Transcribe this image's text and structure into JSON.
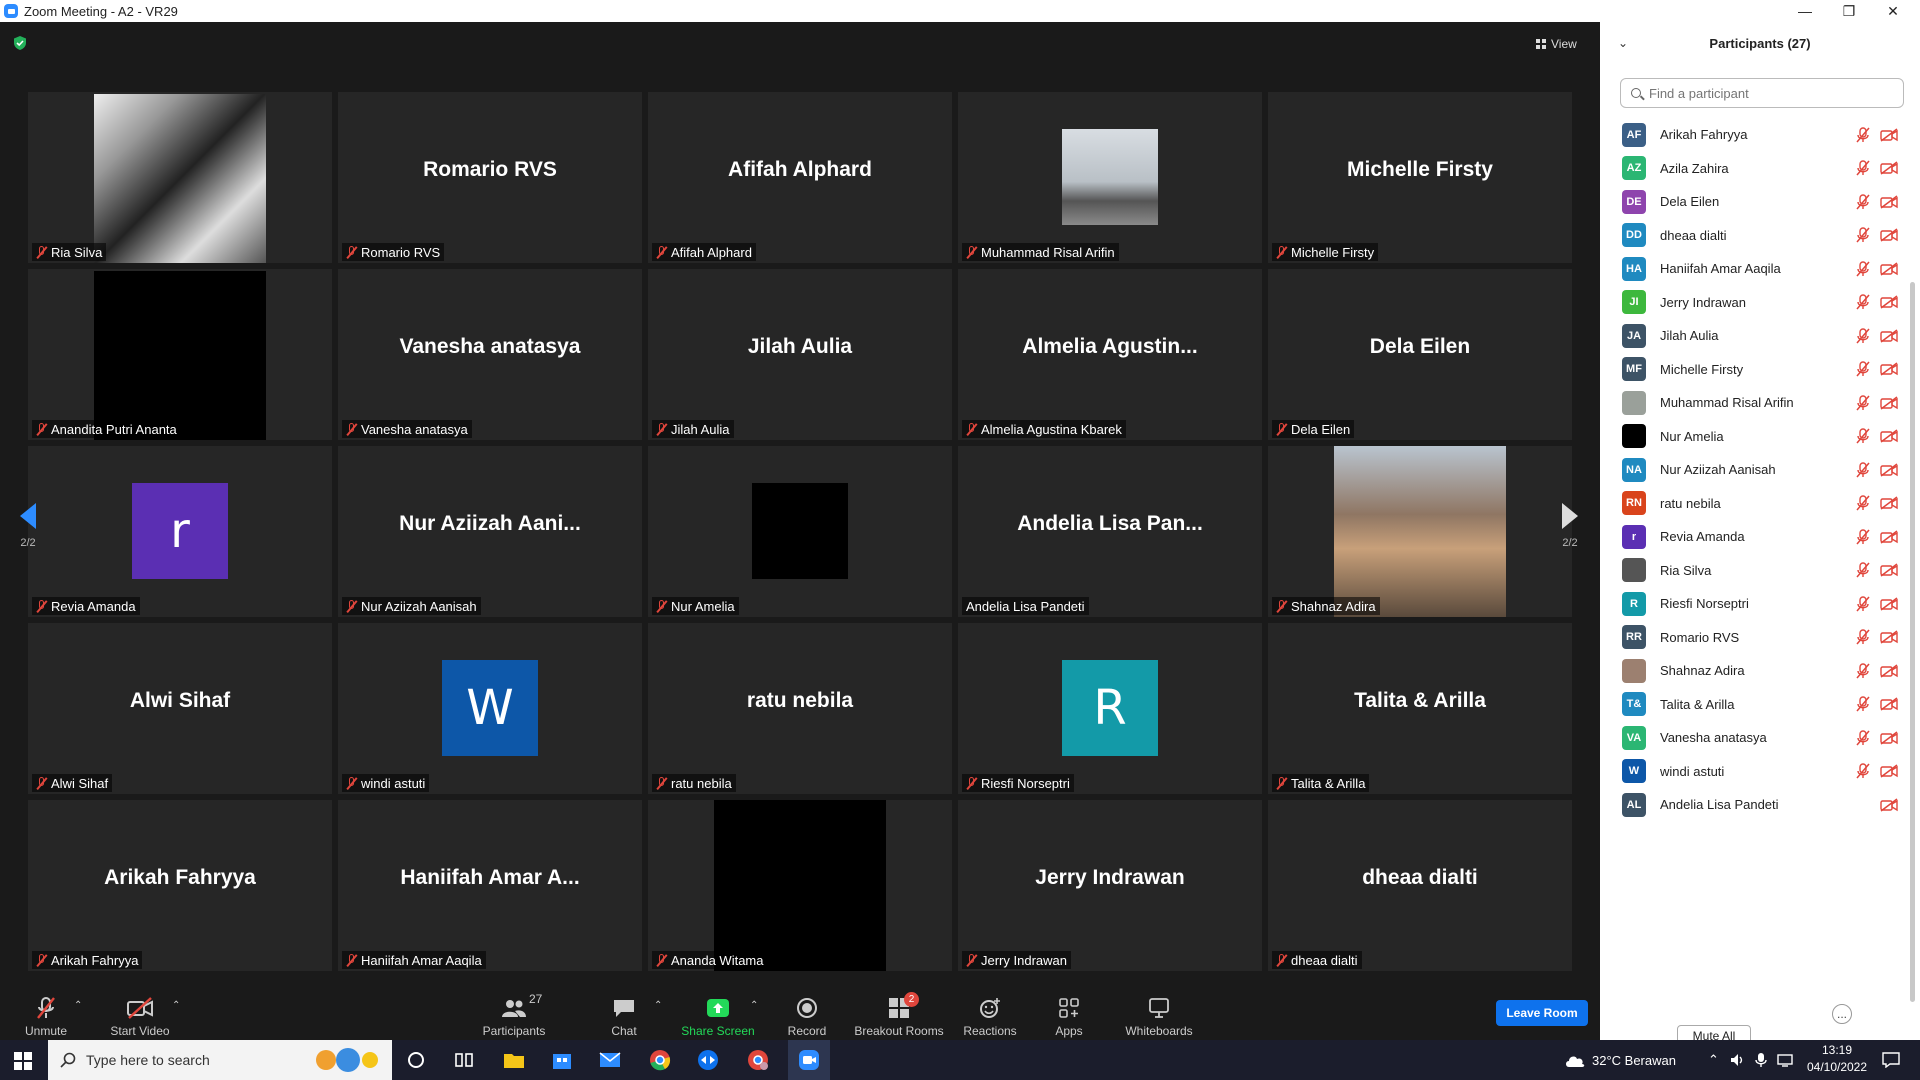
{
  "window": {
    "title": "Zoom Meeting - A2 - VR29"
  },
  "top": {
    "view_label": "View"
  },
  "pager": {
    "left_label": "2/2",
    "right_label": "2/2"
  },
  "tiles": [
    {
      "big": "",
      "label": "Ria Silva",
      "muted": true
    },
    {
      "big": "Romario RVS",
      "label": "Romario RVS",
      "muted": true
    },
    {
      "big": "Afifah Alphard",
      "label": "Afifah Alphard",
      "muted": true
    },
    {
      "big": "",
      "label": "Muhammad Risal Arifin",
      "muted": true
    },
    {
      "big": "Michelle Firsty",
      "label": "Michelle Firsty",
      "muted": true
    },
    {
      "big": "",
      "label": "Anandita Putri Ananta",
      "muted": true
    },
    {
      "big": "Vanesha anatasya",
      "label": "Vanesha anatasya",
      "muted": true
    },
    {
      "big": "Jilah Aulia",
      "label": "Jilah Aulia",
      "muted": true
    },
    {
      "big": "Almelia  Agustin...",
      "label": "Almelia Agustina Kbarek",
      "muted": true
    },
    {
      "big": "Dela Eilen",
      "label": "Dela Eilen",
      "muted": true
    },
    {
      "big": "",
      "label": "Revia Amanda",
      "muted": true,
      "avatar": "r"
    },
    {
      "big": "Nur Aziizah Aani...",
      "label": "Nur Aziizah Aanisah",
      "muted": true
    },
    {
      "big": "",
      "label": "Nur Amelia",
      "muted": true
    },
    {
      "big": "Andelia Lisa Pan...",
      "label": "Andelia Lisa Pandeti",
      "muted": false
    },
    {
      "big": "",
      "label": "Shahnaz Adira",
      "muted": true
    },
    {
      "big": "Alwi Sihaf",
      "label": "Alwi Sihaf",
      "muted": true
    },
    {
      "big": "",
      "label": "windi astuti",
      "muted": true,
      "avatar": "W"
    },
    {
      "big": "ratu nebila",
      "label": "ratu nebila",
      "muted": true
    },
    {
      "big": "",
      "label": "Riesfi Norseptri",
      "muted": true,
      "avatar": "R"
    },
    {
      "big": "Talita & Arilla",
      "label": "Talita & Arilla",
      "muted": true
    },
    {
      "big": "Arikah Fahryya",
      "label": "Arikah Fahryya",
      "muted": true
    },
    {
      "big": "Haniifah Amar A...",
      "label": "Haniifah Amar Aaqila",
      "muted": true
    },
    {
      "big": "",
      "label": "Ananda Witama",
      "muted": true
    },
    {
      "big": "Jerry Indrawan",
      "label": "Jerry Indrawan",
      "muted": true
    },
    {
      "big": "dheaa dialti",
      "label": "dheaa dialti",
      "muted": true
    }
  ],
  "toolbar": {
    "unmute": "Unmute",
    "start_video": "Start Video",
    "participants": "Participants",
    "participants_count": "27",
    "chat": "Chat",
    "share_screen": "Share Screen",
    "record": "Record",
    "breakout_rooms": "Breakout Rooms",
    "breakout_badge": "2",
    "reactions": "Reactions",
    "apps": "Apps",
    "whiteboards": "Whiteboards",
    "leave": "Leave Room"
  },
  "panel": {
    "title": "Participants (27)",
    "search_placeholder": "Find a participant",
    "mute_all": "Mute All",
    "more": "...",
    "participants": [
      {
        "initials": "AF",
        "name": "Arikah Fahryya",
        "color": "#3b5f86",
        "mic_muted": true
      },
      {
        "initials": "AZ",
        "name": "Azila Zahira",
        "color": "#2bb673",
        "mic_muted": true
      },
      {
        "initials": "DE",
        "name": "Dela Eilen",
        "color": "#8e44ad",
        "mic_muted": true
      },
      {
        "initials": "DD",
        "name": "dheaa dialti",
        "color": "#1f8ac0",
        "mic_muted": true
      },
      {
        "initials": "HA",
        "name": "Haniifah Amar Aaqila",
        "color": "#1f8ac0",
        "mic_muted": true
      },
      {
        "initials": "JI",
        "name": "Jerry Indrawan",
        "color": "#3db83d",
        "mic_muted": true
      },
      {
        "initials": "JA",
        "name": "Jilah Aulia",
        "color": "#3d5366",
        "mic_muted": true
      },
      {
        "initials": "MF",
        "name": "Michelle Firsty",
        "color": "#3d5366",
        "mic_muted": true
      },
      {
        "initials": "",
        "name": "Muhammad Risal Arifin",
        "color": "#9aa09a",
        "mic_muted": true
      },
      {
        "initials": "",
        "name": "Nur Amelia",
        "color": "#000000",
        "mic_muted": true
      },
      {
        "initials": "NA",
        "name": "Nur Aziizah Aanisah",
        "color": "#1f8ac0",
        "mic_muted": true
      },
      {
        "initials": "RN",
        "name": "ratu nebila",
        "color": "#d9441c",
        "mic_muted": true
      },
      {
        "initials": "r",
        "name": "Revia Amanda",
        "color": "#5b2fb3",
        "mic_muted": true
      },
      {
        "initials": "",
        "name": "Ria Silva",
        "color": "#555555",
        "mic_muted": true
      },
      {
        "initials": "R",
        "name": "Riesfi Norseptri",
        "color": "#139aa8",
        "mic_muted": true
      },
      {
        "initials": "RR",
        "name": "Romario RVS",
        "color": "#3d5366",
        "mic_muted": true
      },
      {
        "initials": "",
        "name": "Shahnaz Adira",
        "color": "#9c8070",
        "mic_muted": true
      },
      {
        "initials": "T&",
        "name": "Talita & Arilla",
        "color": "#1f8ac0",
        "mic_muted": true
      },
      {
        "initials": "VA",
        "name": "Vanesha anatasya",
        "color": "#2bb673",
        "mic_muted": true
      },
      {
        "initials": "W",
        "name": "windi astuti",
        "color": "#0d57a8",
        "mic_muted": true
      },
      {
        "initials": "AL",
        "name": "Andelia Lisa Pandeti",
        "color": "#3d5366",
        "mic_muted": false
      }
    ]
  },
  "taskbar": {
    "search_placeholder": "Type here to search",
    "weather": "32°C  Berawan",
    "time": "13:19",
    "date": "04/10/2022"
  },
  "colors": {
    "accent": "#2d8cff",
    "muted_red": "#e0463c",
    "share_green": "#23d959",
    "leave_blue": "#0e72ed"
  }
}
